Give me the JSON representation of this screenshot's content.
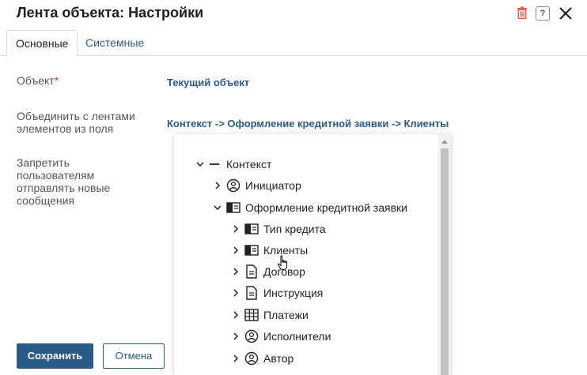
{
  "header": {
    "title": "Лента объекта: Настройки",
    "help_glyph": "?",
    "icons": [
      "trash-icon",
      "help-icon",
      "close-icon"
    ],
    "trash_color": "#d9534f"
  },
  "tabs": [
    {
      "label": "Основные",
      "active": true
    },
    {
      "label": "Системные",
      "active": false
    }
  ],
  "form": {
    "object_label": "Объект",
    "required_mark": "*",
    "object_value": "Текущий объект",
    "merge_label": "Объединить с лентами элементов из поля",
    "merge_value": "Контекст -> Оформление кредитной заявки -> Клиенты",
    "forbid_label": "Запретить пользователям отправлять новые сообщения"
  },
  "buttons": {
    "save": "Сохранить",
    "cancel": "Отмена"
  },
  "tree": {
    "root": {
      "label": "Контекст",
      "icon": "dash-icon",
      "expanded": true
    },
    "level1": [
      {
        "label": "Инициатор",
        "icon": "user-circle-icon",
        "expanded": false
      },
      {
        "label": "Оформление кредитной заявки",
        "icon": "card-icon",
        "expanded": true
      }
    ],
    "level2": [
      {
        "label": "Тип кредита",
        "icon": "card-icon"
      },
      {
        "label": "Клиенты",
        "icon": "card-icon"
      },
      {
        "label": "Договор",
        "icon": "document-icon"
      },
      {
        "label": "Инструкция",
        "icon": "document-icon"
      },
      {
        "label": "Платежи",
        "icon": "table-icon"
      },
      {
        "label": "Исполнители",
        "icon": "user-circle-icon"
      },
      {
        "label": "Автор",
        "icon": "user-circle-icon"
      }
    ]
  },
  "colors": {
    "accent": "#2c5a87",
    "required": "#d23a3a"
  }
}
